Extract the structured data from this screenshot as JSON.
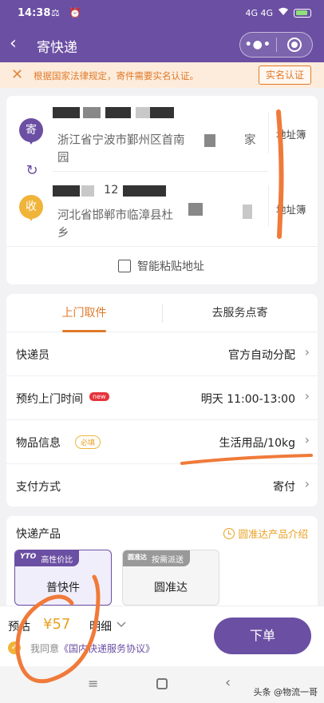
{
  "status_bar": {
    "time": "14:38",
    "notification_icons": "⚖ ⏰",
    "network": "4G 4G",
    "signal_icon": "wifi-icon",
    "battery_icon": "battery-icon"
  },
  "nav": {
    "title": "寄快递",
    "back_icon": "‹",
    "more_icon": "•●•",
    "close_icon": "target-icon"
  },
  "notice": {
    "text": "根据国家法律规定，寄件需要实名认证。",
    "button": "实名认证",
    "close_icon": "✕"
  },
  "address": {
    "sender": {
      "icon_label": "寄",
      "line1": "浙江省宁波市鄞州区首南",
      "line1_tail": "家",
      "line2": "园",
      "book_label": "地址簿"
    },
    "swap_icon": "↻",
    "receiver": {
      "icon_label": "收",
      "name_partial": "12",
      "line1": "河北省邯郸市临漳县杜",
      "line2": "乡",
      "book_label": "地址簿"
    },
    "paste_label": "智能粘贴地址"
  },
  "pickup": {
    "tabs": [
      {
        "label": "上门取件",
        "active": true
      },
      {
        "label": "去服务点寄",
        "active": false
      }
    ],
    "rows": [
      {
        "label": "快递员",
        "value": "官方自动分配"
      },
      {
        "label": "预约上门时间",
        "badge": "new",
        "value": "明天 11:00-13:00"
      },
      {
        "label": "物品信息",
        "badge": "必填",
        "value": "生活用品/10kg"
      },
      {
        "label": "支付方式",
        "value": "寄付"
      }
    ],
    "chevron": "›"
  },
  "products": {
    "title": "快递产品",
    "intro_link": "圆准达产品介绍",
    "options": [
      {
        "logo": "YTO",
        "tag": "高性价比",
        "name": "普快件",
        "selected": true
      },
      {
        "logo": "圆准达",
        "tag": "按需派送",
        "name": "圆准达",
        "selected": false
      }
    ]
  },
  "bottom": {
    "estimate_label": "预估",
    "price": "¥57",
    "detail_label": "明细",
    "agree_prefix": "我同意",
    "agree_link": "《国内快递服务协议》",
    "check_icon": "✓",
    "order_button": "下单"
  },
  "system_nav": {
    "menu_icon": "≡",
    "back_icon": "‹",
    "watermark": "头条 @物流一哥"
  },
  "colors": {
    "brand": "#6b4fa3",
    "accent": "#e07a2a",
    "gold": "#e8a020",
    "annotation": "#f07a3a"
  }
}
